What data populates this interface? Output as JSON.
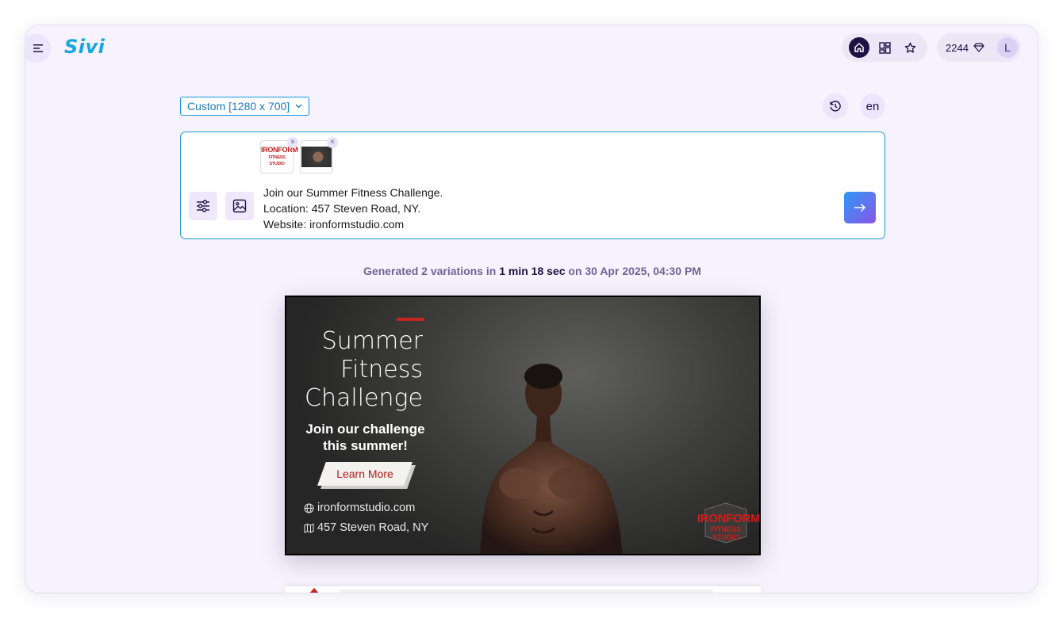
{
  "app": {
    "logo": "Sivi"
  },
  "header": {
    "credits": "2244",
    "avatar_initial": "L"
  },
  "toolbar": {
    "size_select_value": "Custom [1280 x 700]",
    "language": "en"
  },
  "prompt": {
    "lines": [
      "Join our Summer Fitness Challenge.",
      "Location: 457 Steven Road, NY.",
      "Website: ironformstudio.com"
    ],
    "attachments": [
      {
        "kind": "logo",
        "line1": "IRONFORM",
        "line2": "FITNESS STUDIO"
      },
      {
        "kind": "photo"
      }
    ],
    "remove_label": "×"
  },
  "generation": {
    "prefix": "Generated 2 variations in",
    "duration": "1 min 18 sec",
    "suffix": "on 30 Apr 2025, 04:30 PM"
  },
  "banner": {
    "title_lines": [
      "Summer",
      "Fitness",
      "Challenge"
    ],
    "sub_lines": [
      "Join our challenge",
      "this summer!"
    ],
    "cta": "Learn More",
    "website": "ironformstudio.com",
    "address": "457 Steven Road, NY",
    "logo_line1": "IRONFORM",
    "logo_line2": "FITNESS STUDIO",
    "accent_color": "#c62323"
  },
  "colors": {
    "brand": "#18a6df",
    "background": "#f6f3fe",
    "dark": "#1d1244",
    "accent": "#c62323"
  },
  "icons": {
    "menu": "menu-icon",
    "home": "home-icon",
    "grid": "grid-icon",
    "star": "star-icon",
    "diamond": "diamond-icon",
    "history": "history-icon",
    "filters": "sliders-icon",
    "image": "image-icon",
    "submit": "arrow-right-icon",
    "globe": "globe-icon",
    "map": "map-icon"
  }
}
